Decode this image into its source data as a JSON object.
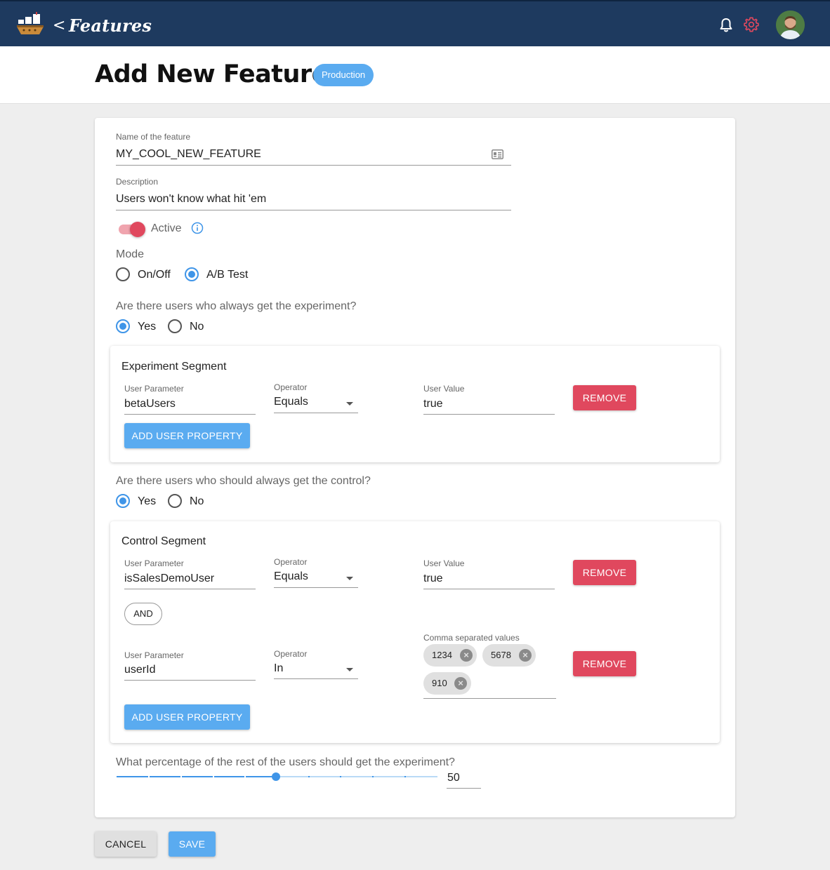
{
  "topbar": {
    "back_label": "<",
    "title": "Features",
    "logo_icon": "ship-logo-icon",
    "notifications_icon": "bell-icon",
    "settings_icon": "gear-icon",
    "avatar_icon": "user-avatar"
  },
  "header": {
    "title": "Add New Feature",
    "environment": "Production"
  },
  "form": {
    "name_label": "Name of the feature",
    "name_value": "MY_COOL_NEW_FEATURE",
    "description_label": "Description",
    "description_value": "Users won't know what hit 'em",
    "active_label": "Active",
    "active": true,
    "mode_label": "Mode",
    "mode_options": [
      "On/Off",
      "A/B Test"
    ],
    "mode_selected": "A/B Test",
    "experiment_question": "Are there users who always get the experiment?",
    "experiment_options": [
      "Yes",
      "No"
    ],
    "experiment_selected": "Yes",
    "control_question": "Are there users who should always get the control?",
    "control_options": [
      "Yes",
      "No"
    ],
    "control_selected": "Yes",
    "percentage_question": "What percentage of the rest of the users should get the experiment?",
    "percentage_value": "50"
  },
  "experiment_segment": {
    "title": "Experiment Segment",
    "rules": [
      {
        "param_label": "User Parameter",
        "param_value": "betaUsers",
        "operator_label": "Operator",
        "operator_value": "Equals",
        "value_label": "User Value",
        "value": "true",
        "remove_label": "REMOVE"
      }
    ],
    "add_label": "ADD USER PROPERTY"
  },
  "control_segment": {
    "title": "Control Segment",
    "rules": [
      {
        "param_label": "User Parameter",
        "param_value": "isSalesDemoUser",
        "operator_label": "Operator",
        "operator_value": "Equals",
        "value_label": "User Value",
        "value": "true",
        "remove_label": "REMOVE"
      },
      {
        "param_label": "User Parameter",
        "param_value": "userId",
        "operator_label": "Operator",
        "operator_value": "In",
        "value_label": "Comma separated values",
        "values": [
          "1234",
          "5678",
          "910"
        ],
        "remove_label": "REMOVE"
      }
    ],
    "and_label": "AND",
    "add_label": "ADD USER PROPERTY"
  },
  "actions": {
    "cancel_label": "CANCEL",
    "save_label": "SAVE"
  },
  "colors": {
    "topbar": "#1e3a5f",
    "primary": "#5aabf0",
    "danger": "#e0485e"
  }
}
